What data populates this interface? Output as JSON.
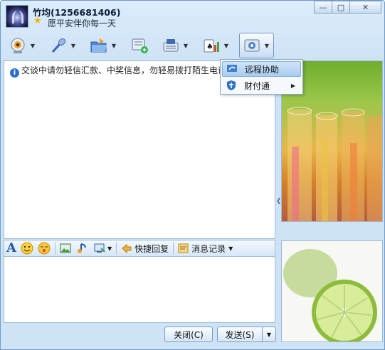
{
  "header": {
    "contact_name": "竹均(1256681406)",
    "signature": "愿平安伴你每一天"
  },
  "window_controls": {
    "minimize": "—",
    "maximize": "□",
    "close": "✕"
  },
  "toolbar": {
    "tools": [
      {
        "name": "video-call",
        "icon": "webcam-icon"
      },
      {
        "name": "voice-call",
        "icon": "microphone-icon"
      },
      {
        "name": "send-file",
        "icon": "folder-icon"
      },
      {
        "name": "create-group",
        "icon": "group-chat-icon"
      },
      {
        "name": "app-launcher",
        "icon": "apps-icon"
      },
      {
        "name": "games",
        "icon": "cards-icon"
      },
      {
        "name": "more-apps",
        "icon": "settings-icon"
      }
    ]
  },
  "dropdown_menu": {
    "items": [
      {
        "label": "远程协助",
        "icon": "remote-assist-icon",
        "highlighted": true
      },
      {
        "label": "财付通",
        "icon": "tenpay-shield-icon",
        "has_submenu": true
      }
    ]
  },
  "chat": {
    "notice": "交谈中请勿轻信汇款、中奖信息，勿轻易拨打陌生电话"
  },
  "input_toolbar": {
    "quick_reply_label": "快捷回复",
    "message_log_label": "消息记录"
  },
  "buttons": {
    "close_label": "关闭(C)",
    "send_label": "发送(S)"
  },
  "colors": {
    "window_bg": "#cfe3f7",
    "border": "#6e9cc8",
    "menu_highlight": "#a9ccf0"
  }
}
